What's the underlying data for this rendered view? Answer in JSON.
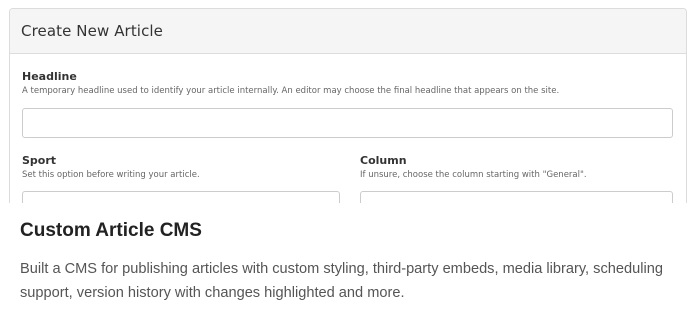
{
  "panel": {
    "title": "Create New Article"
  },
  "form": {
    "headline": {
      "label": "Headline",
      "help": "A temporary headline used to identify your article internally. An editor may choose the final headline that appears on the site.",
      "value": ""
    },
    "sport": {
      "label": "Sport",
      "help": "Set this option before writing your article.",
      "value": ""
    },
    "column": {
      "label": "Column",
      "help": "If unsure, choose the column starting with \"General\".",
      "value": ""
    }
  },
  "caption": {
    "title": "Custom Article CMS",
    "text": "Built a CMS for publishing articles with custom styling, third-party embeds, media library, scheduling support, version history with changes highlighted and more."
  }
}
